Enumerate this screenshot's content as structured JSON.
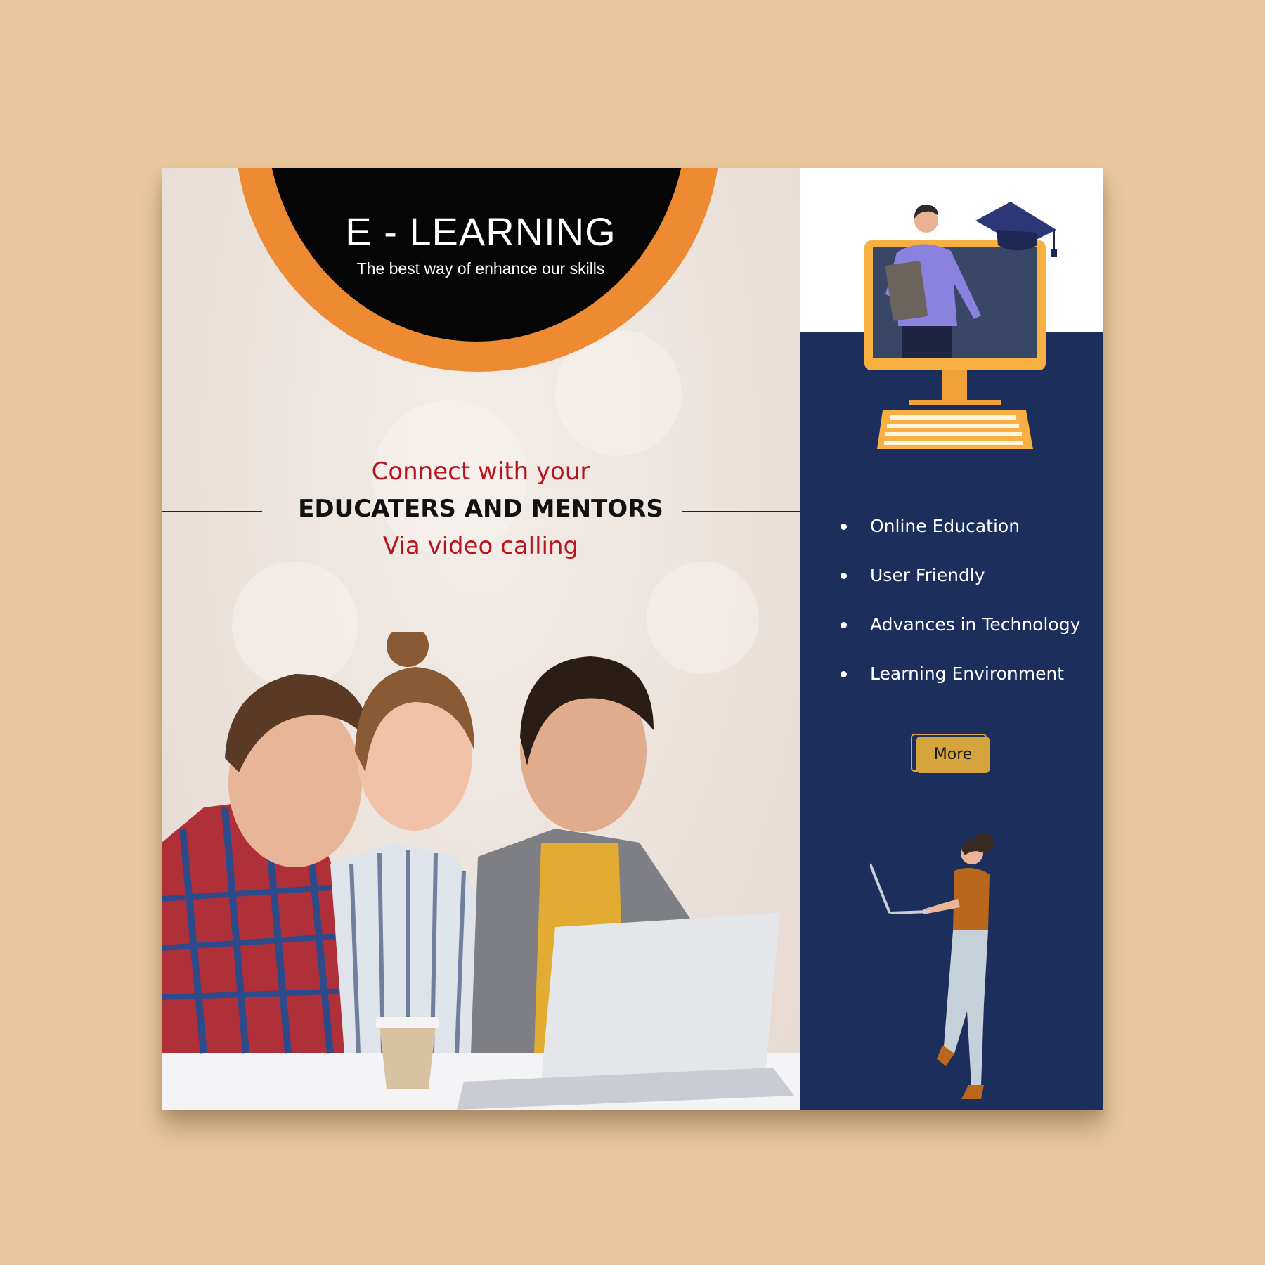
{
  "brand": {
    "title": "E - LEARNING",
    "tagline": "The best way of enhance our skills"
  },
  "headline": {
    "line1": "Connect with your",
    "line2": "EDUCATERS AND MENTORS",
    "line3": "Via video calling"
  },
  "features": [
    {
      "label": "Online Education"
    },
    {
      "label": "User Friendly"
    },
    {
      "label": "Advances in Technology"
    },
    {
      "label": "Learning Environment"
    }
  ],
  "cta": {
    "label": "More"
  },
  "colors": {
    "background": "#e8c79c",
    "orange": "#ee8a32",
    "navy": "#1c2f5c",
    "red": "#b8141d",
    "gold": "#d5a43d"
  },
  "icons": [
    "graduation-cap-icon",
    "computer-monitor-icon",
    "keyboard-icon"
  ]
}
